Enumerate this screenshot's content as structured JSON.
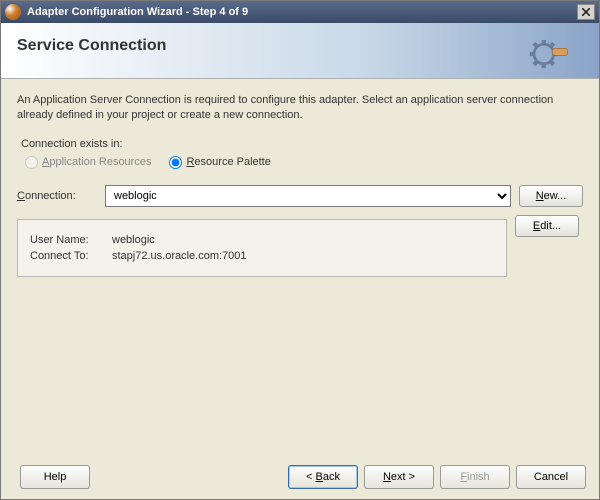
{
  "window": {
    "title": "Adapter Configuration Wizard - Step 4 of 9"
  },
  "banner": {
    "heading": "Service Connection"
  },
  "description": "An Application Server Connection is required to configure this adapter. Select an application server connection already defined in your project or create a new connection.",
  "exists_in": {
    "label": "Connection exists in:",
    "app_resources": "pplication Resources",
    "resource_palette": "esource Palette"
  },
  "connection": {
    "label": "Connection:",
    "selected": "weblogic",
    "new_btn": "New...",
    "edit_btn": "Edit..."
  },
  "details": {
    "user_name_label": "User Name:",
    "user_name_value": "weblogic",
    "connect_to_label": "Connect To:",
    "connect_to_value": "stapj72.us.oracle.com:7001"
  },
  "footer": {
    "help": "Help",
    "back": "< Back",
    "next": "Next >",
    "finish": "Finish",
    "cancel": "Cancel"
  }
}
